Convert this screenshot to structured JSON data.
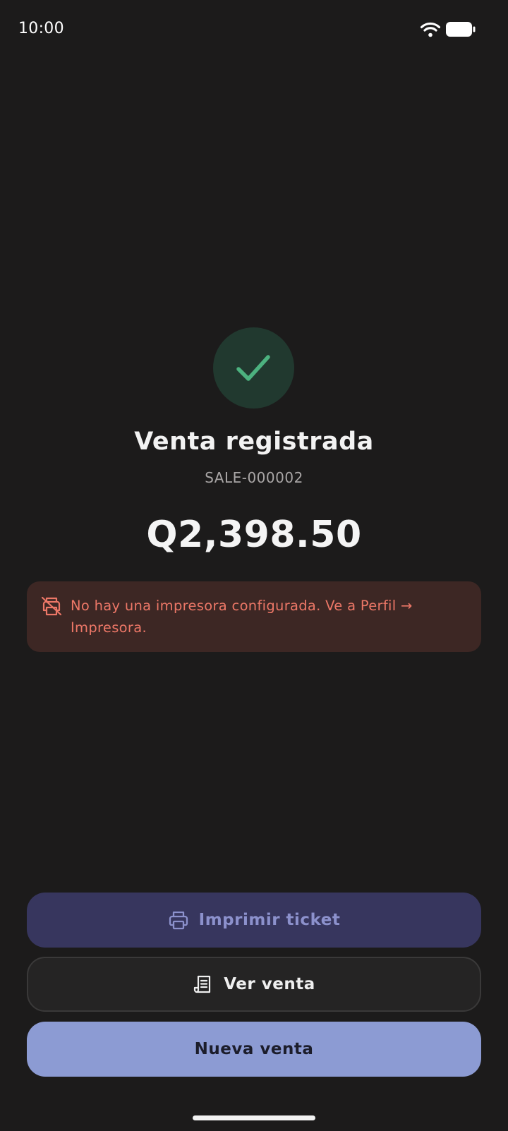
{
  "status_bar": {
    "time": "10:00"
  },
  "confirmation": {
    "title": "Venta registrada",
    "sale_id": "SALE-000002",
    "amount": "Q2,398.50"
  },
  "alert": {
    "message": "No hay una impresora configurada. Ve a Perfil → Impresora."
  },
  "actions": {
    "print_label": "Imprimir ticket",
    "view_label": "Ver venta",
    "new_label": "Nueva venta"
  },
  "icons": {
    "success": "checkmark-icon",
    "alert": "printer-off-icon",
    "print": "printer-icon",
    "view": "receipt-icon",
    "wifi": "wifi-icon",
    "battery": "battery-icon"
  },
  "colors": {
    "background": "#1c1b1b",
    "success_green": "#4cb27f",
    "alert_background": "#3d2724",
    "alert_text": "#ec7767",
    "primary_button": "#8c9bd3",
    "disabled_button": "#37365e"
  }
}
